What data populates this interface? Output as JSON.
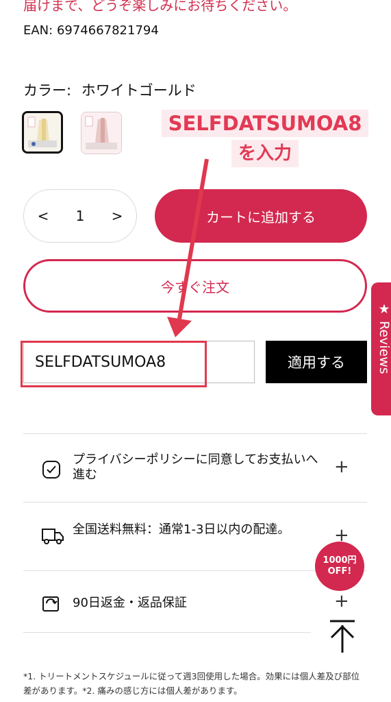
{
  "intro_text": "届けまで、どうぞ楽しみにお待ちください。",
  "ean": "EAN: 6974667821794",
  "color": {
    "label": "カラー:",
    "value": "ホワイトゴールド"
  },
  "annotation": {
    "line1": "SELFDATSUMOA8",
    "line2": "を入力"
  },
  "quantity": {
    "minus": "<",
    "value": "1",
    "plus": ">"
  },
  "buttons": {
    "add_to_cart": "カートに追加する",
    "buy_now": "今すぐ注文",
    "apply": "適用する"
  },
  "coupon": {
    "value": "SELFDATSUMOA8"
  },
  "reviews_tab": {
    "label": "Reviews"
  },
  "accordion": [
    {
      "text": "プライバシーポリシーに同意してお支払いへ進む",
      "plus": "+"
    },
    {
      "text": "全国送料無料：通常1-3日以内の配達。",
      "plus": "+"
    },
    {
      "text": "90日返金・返品保証",
      "plus": "+"
    }
  ],
  "badge": {
    "line1": "1000円",
    "line2": "OFF!"
  },
  "footnote": "*1. トリートメントスケジュールに従って週3回使用した場合。効果には個人差及び部位差があります。*2. 痛みの感じ方には個人差があります。",
  "colors": {
    "accent": "#d3284f",
    "annotation_red": "#e0384e"
  }
}
